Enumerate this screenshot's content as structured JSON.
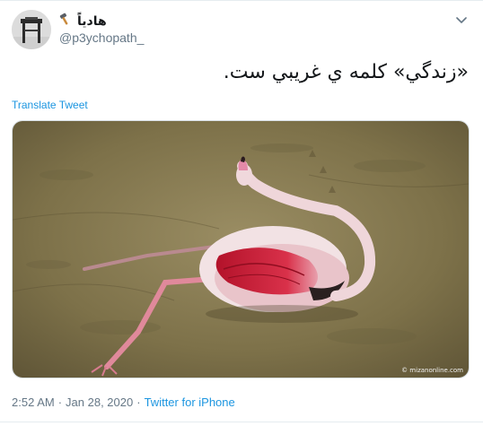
{
  "author": {
    "display_name": "هادیاً",
    "handle": "@p3ychopath_"
  },
  "tweet": {
    "text": "«زندگي» كلمه ي غريبي ست.",
    "translate_label": "Translate Tweet"
  },
  "media": {
    "watermark": "© mizanonline.com"
  },
  "meta": {
    "time": "2:52 AM",
    "separator": "·",
    "date": "Jan 28, 2020",
    "separator2": "·",
    "source": "Twitter for iPhone"
  },
  "colors": {
    "link": "#1b95e0",
    "secondary_text": "#657786"
  },
  "icons": {
    "name_badge": "hammer-icon",
    "menu": "chevron-down-icon"
  }
}
